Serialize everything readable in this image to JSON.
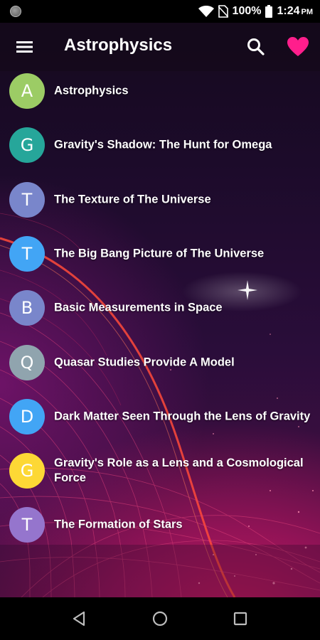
{
  "status_bar": {
    "battery_text": "100%",
    "time": "1:24",
    "ampm": "PM"
  },
  "app_bar": {
    "title": "Astrophysics",
    "menu_icon": "hamburger-menu-icon",
    "search_icon": "search-icon",
    "favorite_icon": "heart-icon",
    "favorite_color": "#ff1e8c"
  },
  "items": [
    {
      "letter": "A",
      "title": "Astrophysics",
      "color": "#9ccc65"
    },
    {
      "letter": "G",
      "title": "Gravity's Shadow: The Hunt for Omega",
      "color": "#26a69a"
    },
    {
      "letter": "T",
      "title": "The Texture of The Universe",
      "color": "#7986cb"
    },
    {
      "letter": "T",
      "title": "The Big Bang Picture of The Universe",
      "color": "#42a5f5"
    },
    {
      "letter": "B",
      "title": "Basic Measurements in Space",
      "color": "#7986cb"
    },
    {
      "letter": "Q",
      "title": "Quasar Studies Provide A Model",
      "color": "#90a4ae"
    },
    {
      "letter": "D",
      "title": "Dark Matter Seen Through the Lens of Gravity",
      "color": "#42a5f5"
    },
    {
      "letter": "G",
      "title": "Gravity's Role as a Lens and a Cosmological Force",
      "color": "#fdd835"
    },
    {
      "letter": "T",
      "title": "The Formation of Stars",
      "color": "#9575cd"
    }
  ],
  "nav_bar": {
    "back_icon": "back-triangle-icon",
    "home_icon": "home-circle-icon",
    "recents_icon": "recents-square-icon"
  }
}
